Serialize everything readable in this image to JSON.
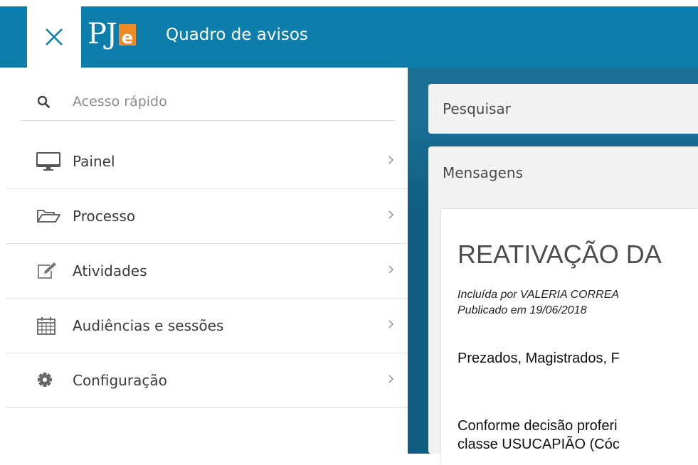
{
  "header": {
    "logo_text": "PJe",
    "title": "Quadro de avisos",
    "close_icon": "close-icon",
    "accent_color": "#0d7dab"
  },
  "sidebar": {
    "search": {
      "placeholder": "Acesso rápido",
      "icon": "search-icon"
    },
    "items": [
      {
        "label": "Painel",
        "icon": "monitor-icon"
      },
      {
        "label": "Processo",
        "icon": "folder-open-icon"
      },
      {
        "label": "Atividades",
        "icon": "edit-icon"
      },
      {
        "label": "Audiências e sessões",
        "icon": "calendar-icon"
      },
      {
        "label": "Configuração",
        "icon": "gear-icon"
      }
    ]
  },
  "main": {
    "search_panel": {
      "title": "Pesquisar"
    },
    "messages_panel": {
      "title": "Mensagens",
      "message": {
        "title": "REATIVAÇÃO DA",
        "author_line": "Incluída por VALERIA CORREA",
        "published_line": "Publicado em 19/06/2018",
        "paragraph1": "Prezados,  Magistrados, F",
        "paragraph2_line1": "Conforme decisão proferi",
        "paragraph2_line2": "classe USUCAPIÃO (Cóc"
      }
    }
  }
}
